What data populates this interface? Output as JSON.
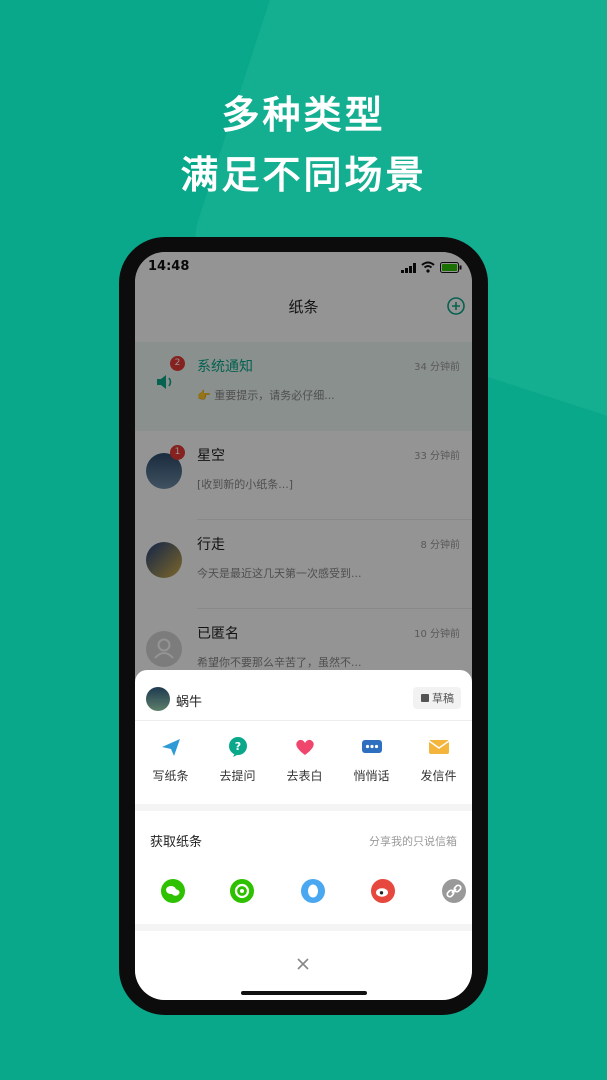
{
  "headline": {
    "line1": "多种类型",
    "line2": "满足不同场景"
  },
  "status": {
    "time": "14:48"
  },
  "nav": {
    "title": "纸条"
  },
  "messages": [
    {
      "name": "系统通知",
      "time": "34 分钟前",
      "preview": "👉 重要提示，请务必仔细...",
      "badge": "2"
    },
    {
      "name": "星空",
      "time": "33 分钟前",
      "preview": "[收到新的小纸条...]",
      "badge": "1"
    },
    {
      "name": "行走",
      "time": "8 分钟前",
      "preview": "今天是最近这几天第一次感受到..."
    },
    {
      "name": "已匿名",
      "time": "10 分钟前",
      "preview": "希望你不要那么辛苦了，虽然不..."
    }
  ],
  "sheet": {
    "user": "蜗牛",
    "draft": "草稿",
    "actions": [
      {
        "label": "写纸条",
        "icon": "paper-plane-icon",
        "color": "#2e9bd6"
      },
      {
        "label": "去提问",
        "icon": "question-bubble-icon",
        "color": "#0aa88a"
      },
      {
        "label": "去表白",
        "icon": "heart-icon",
        "color": "#f0466e"
      },
      {
        "label": "悄悄话",
        "icon": "chat-dots-icon",
        "color": "#2f6fbf"
      },
      {
        "label": "发信件",
        "icon": "envelope-icon",
        "color": "#f3b53c"
      }
    ],
    "get_title": "获取纸条",
    "share_link": "分享我的只说信箱",
    "share": [
      {
        "icon": "wechat-icon",
        "color": "#2dc100"
      },
      {
        "icon": "moments-icon",
        "color": "#2dc100"
      },
      {
        "icon": "qq-icon",
        "color": "#4aa8f0"
      },
      {
        "icon": "weibo-icon",
        "color": "#e6483e"
      },
      {
        "icon": "link-icon",
        "color": "#999999"
      }
    ]
  },
  "colors": {
    "brand": "#0aa88a",
    "badge": "#e53935"
  }
}
